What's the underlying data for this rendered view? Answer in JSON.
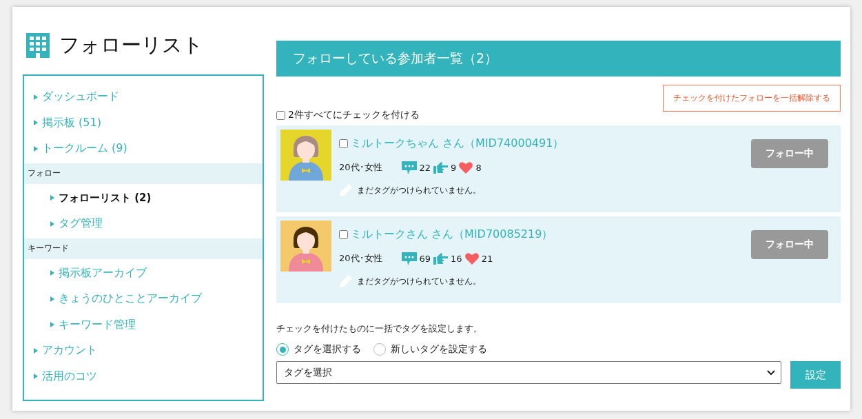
{
  "page_title": "フォローリスト",
  "sidebar": {
    "items": [
      {
        "kind": "link",
        "label": "ダッシュボード",
        "selected": false
      },
      {
        "kind": "link",
        "label": "掲示板 (51)",
        "selected": false
      },
      {
        "kind": "link",
        "label": "トークルーム (9)",
        "selected": false
      },
      {
        "kind": "section",
        "label": "フォロー",
        "children": [
          {
            "kind": "link",
            "label": "フォローリスト (2)",
            "selected": true
          },
          {
            "kind": "link",
            "label": "タグ管理",
            "selected": false
          }
        ]
      },
      {
        "kind": "section",
        "label": "キーワード",
        "children": [
          {
            "kind": "link",
            "label": "掲示板アーカイブ",
            "selected": false
          },
          {
            "kind": "link",
            "label": "きょうのひとことアーカイブ",
            "selected": false
          },
          {
            "kind": "link",
            "label": "キーワード管理",
            "selected": false
          }
        ]
      },
      {
        "kind": "link",
        "label": "アカウント",
        "selected": false
      },
      {
        "kind": "link",
        "label": "活用のコツ",
        "selected": false
      }
    ]
  },
  "panel_title": "フォローしている参加者一覧（2）",
  "unfollow_button": "チェックを付けたフォローを一括解除する",
  "check_all": {
    "label": "2件すべてにチェックを付ける",
    "checked": false
  },
  "members": [
    {
      "name": "ミルトークちゃん さん（MID74000491）",
      "checked": false,
      "color": "#e6d52a",
      "kind": "blue",
      "profile": "20代･女性",
      "comments": "22",
      "likes": "9",
      "hearts": "8",
      "tag_note": "まだタグがつけられていません。",
      "follow_button": "フォロー中"
    },
    {
      "name": "ミルトークさん さん（MID70085219）",
      "checked": false,
      "color": "#f3c96b",
      "kind": "pink",
      "profile": "20代･女性",
      "comments": "69",
      "likes": "16",
      "hearts": "21",
      "tag_note": "まだタグがつけられていません。",
      "follow_button": "フォロー中"
    }
  ],
  "tag_help": "チェックを付けたものに一括でタグを設定します。",
  "tag_modes": [
    {
      "label": "タグを選択する",
      "selected": true
    },
    {
      "label": "新しいタグを設定する",
      "selected": false
    }
  ],
  "tag_select": {
    "value": "タグを選択"
  },
  "set_button": "設定"
}
